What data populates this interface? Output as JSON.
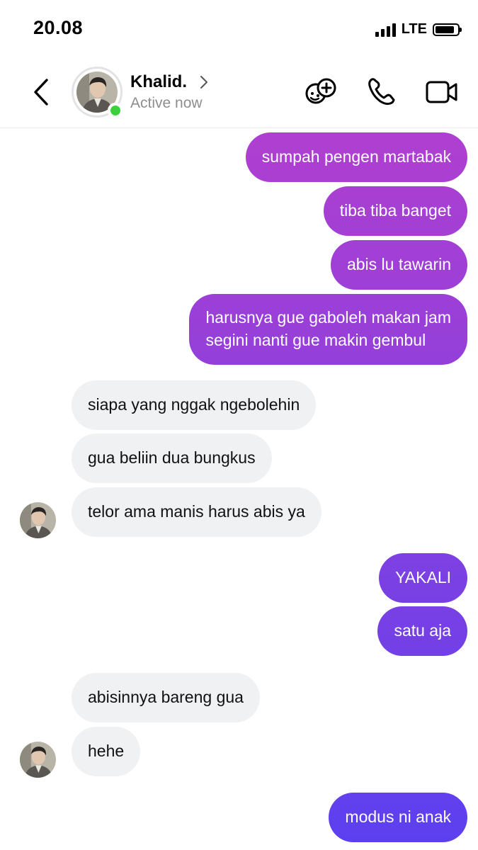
{
  "status_bar": {
    "time": "20.08",
    "network": "LTE",
    "battery_level": 0.85
  },
  "header": {
    "contact_name": "Khalid.",
    "contact_status": "Active now",
    "icons": [
      "back-chevron-icon",
      "chevron-right-icon",
      "effects-icon",
      "phone-icon",
      "video-camera-icon"
    ],
    "online_color": "#3bd13b"
  },
  "messages": [
    {
      "from": "me",
      "text": "sumpah pengen martabak"
    },
    {
      "from": "me",
      "text": "tiba tiba banget"
    },
    {
      "from": "me",
      "text": "abis lu tawarin"
    },
    {
      "from": "me",
      "text": "harusnya gue gaboleh makan jam segini nanti gue makin gembul",
      "lines": [
        "harusnya gue gaboleh makan jam",
        "segini nanti gue makin gembul"
      ]
    },
    {
      "from": "them",
      "text": "siapa yang nggak ngebolehin"
    },
    {
      "from": "them",
      "text": "gua beliin dua bungkus"
    },
    {
      "from": "them",
      "text": "telor ama manis harus abis ya"
    },
    {
      "from": "me",
      "text": "YAKALI"
    },
    {
      "from": "me",
      "text": "satu aja"
    },
    {
      "from": "them",
      "text": "abisinnya bareng gua"
    },
    {
      "from": "them",
      "text": "hehe"
    },
    {
      "from": "me",
      "text": "modus ni anak"
    }
  ],
  "colors": {
    "outgoing_bubble_top": "#b03fd0",
    "outgoing_bubble_bottom": "#5b40ef",
    "incoming_bubble": "#f0f1f3"
  }
}
